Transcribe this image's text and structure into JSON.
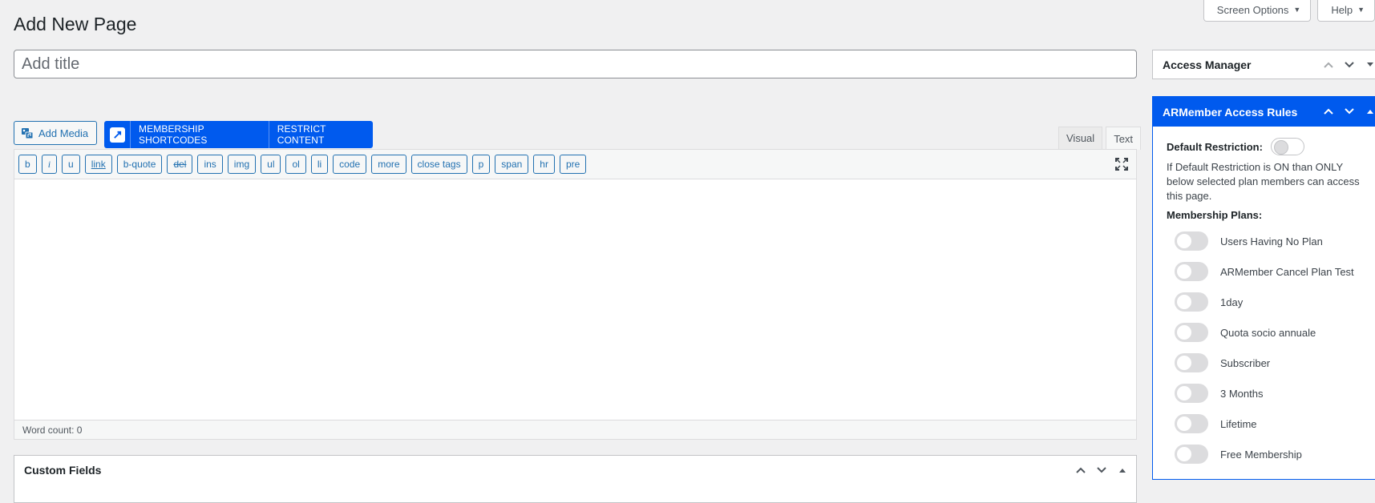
{
  "screen_meta": {
    "screen_options_label": "Screen Options",
    "help_label": "Help"
  },
  "page": {
    "title": "Add New Page",
    "title_placeholder": "Add title"
  },
  "toolbar": {
    "add_media_label": "Add Media",
    "membership_shortcodes_label": "MEMBERSHIP SHORTCODES",
    "restrict_content_label": "RESTRICT CONTENT"
  },
  "editor": {
    "tabs": [
      {
        "label": "Visual",
        "active": false
      },
      {
        "label": "Text",
        "active": true
      }
    ],
    "quicktags": [
      "b",
      "i",
      "u",
      "link",
      "b-quote",
      "del",
      "ins",
      "img",
      "ul",
      "ol",
      "li",
      "code",
      "more",
      "close tags",
      "p",
      "span",
      "hr",
      "pre"
    ],
    "word_count": "Word count: 0"
  },
  "custom_fields": {
    "title": "Custom Fields"
  },
  "access_manager": {
    "title": "Access Manager"
  },
  "armember_rules": {
    "title": "ARMember Access Rules",
    "default_restriction_label": "Default Restriction:",
    "default_restriction_on": false,
    "description": "If Default Restriction is ON than ONLY below selected plan members can access this page.",
    "plans_label": "Membership Plans:",
    "plans": [
      {
        "label": "Users Having No Plan",
        "enabled": false
      },
      {
        "label": "ARMember Cancel Plan Test",
        "enabled": false
      },
      {
        "label": "1day",
        "enabled": false
      },
      {
        "label": "Quota socio annuale",
        "enabled": false
      },
      {
        "label": "Subscriber",
        "enabled": false
      },
      {
        "label": "3 Months",
        "enabled": false
      },
      {
        "label": "Lifetime",
        "enabled": false
      },
      {
        "label": "Free Membership",
        "enabled": false
      }
    ]
  },
  "colors": {
    "accent_blue": "#005aee",
    "wp_blue": "#2271b1",
    "background": "#f0f0f1"
  }
}
